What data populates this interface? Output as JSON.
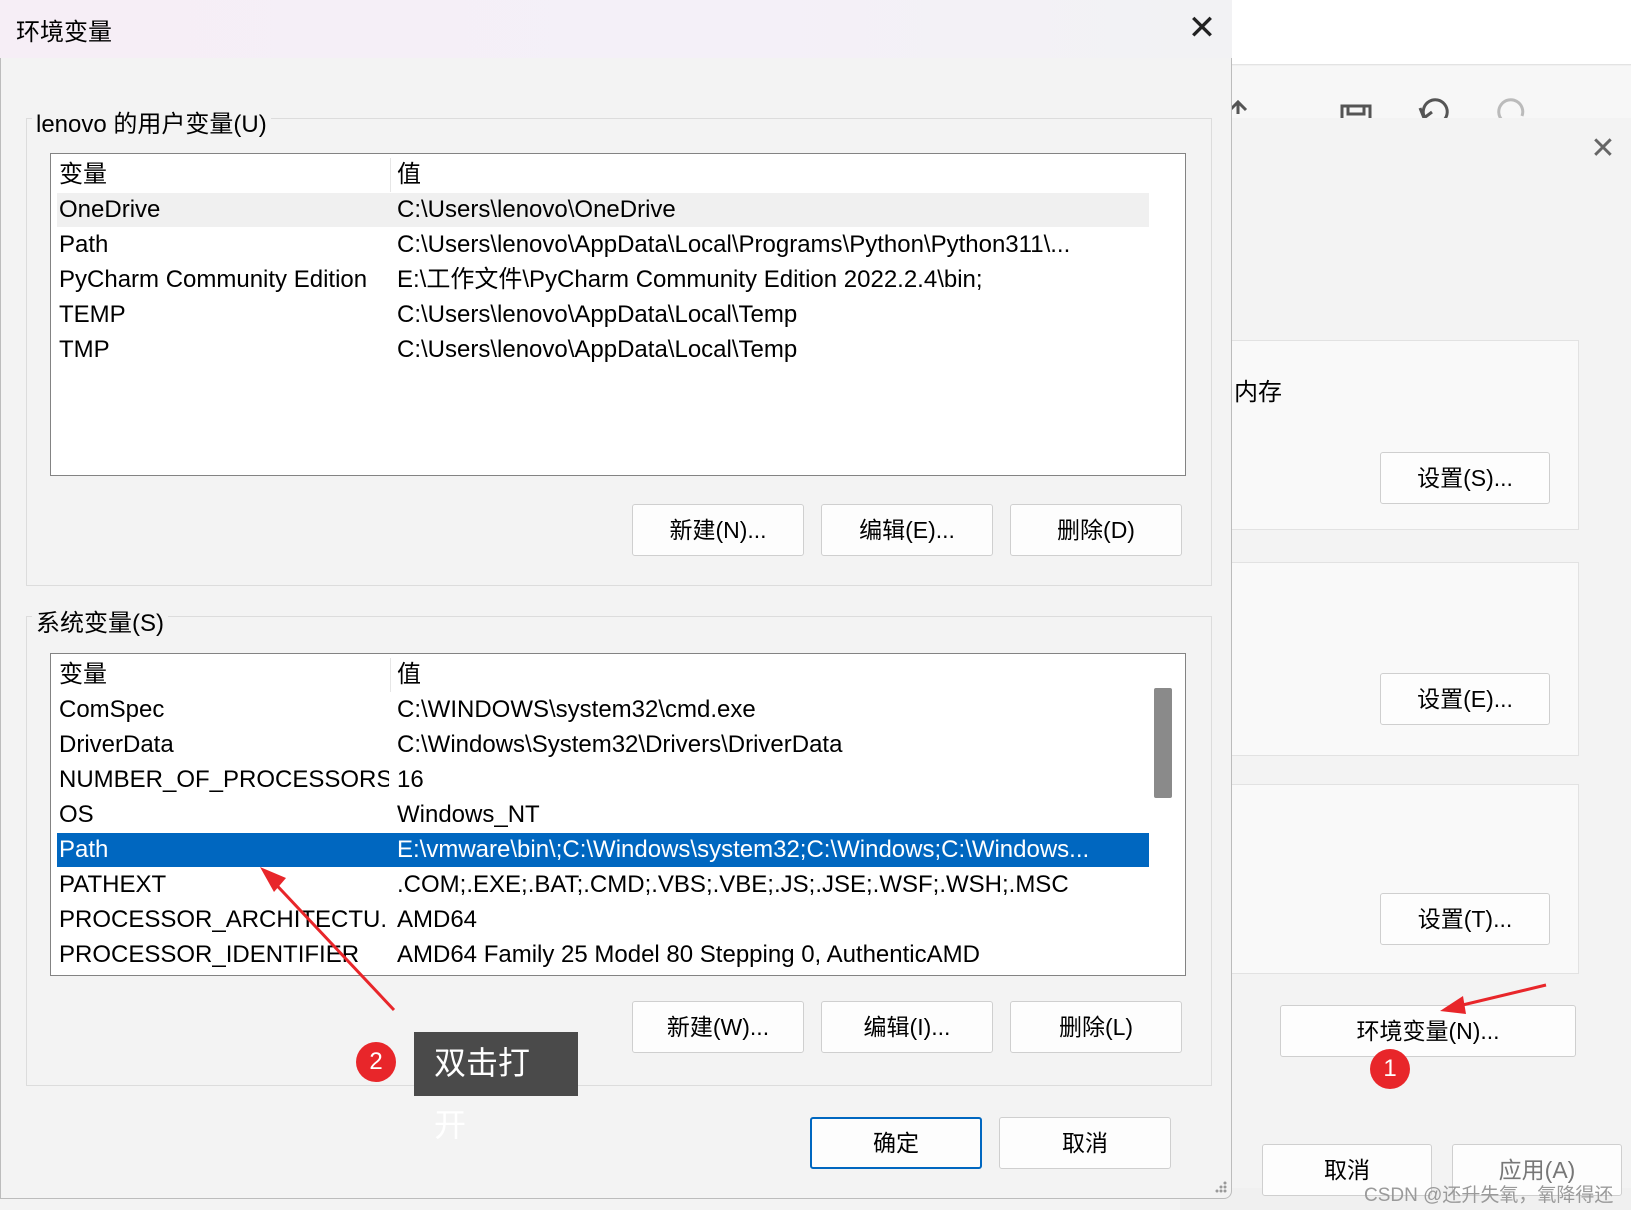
{
  "dialog": {
    "title": "环境变量",
    "close_glyph": "✕"
  },
  "user_vars": {
    "group_title": "lenovo 的用户变量(U)",
    "col_name": "变量",
    "col_value": "值",
    "rows": [
      {
        "name": "OneDrive",
        "value": "C:\\Users\\lenovo\\OneDrive"
      },
      {
        "name": "Path",
        "value": "C:\\Users\\lenovo\\AppData\\Local\\Programs\\Python\\Python311\\..."
      },
      {
        "name": "PyCharm Community Edition",
        "value": "E:\\工作文件\\PyCharm Community Edition 2022.2.4\\bin;"
      },
      {
        "name": "TEMP",
        "value": "C:\\Users\\lenovo\\AppData\\Local\\Temp"
      },
      {
        "name": "TMP",
        "value": "C:\\Users\\lenovo\\AppData\\Local\\Temp"
      }
    ],
    "btn_new": "新建(N)...",
    "btn_edit": "编辑(E)...",
    "btn_delete": "删除(D)"
  },
  "system_vars": {
    "group_title": "系统变量(S)",
    "col_name": "变量",
    "col_value": "值",
    "rows": [
      {
        "name": "ComSpec",
        "value": "C:\\WINDOWS\\system32\\cmd.exe"
      },
      {
        "name": "DriverData",
        "value": "C:\\Windows\\System32\\Drivers\\DriverData"
      },
      {
        "name": "NUMBER_OF_PROCESSORS",
        "value": "16"
      },
      {
        "name": "OS",
        "value": "Windows_NT"
      },
      {
        "name": "Path",
        "value": "E:\\vmware\\bin\\;C:\\Windows\\system32;C:\\Windows;C:\\Windows..."
      },
      {
        "name": "PATHEXT",
        "value": ".COM;.EXE;.BAT;.CMD;.VBS;.VBE;.JS;.JSE;.WSF;.WSH;.MSC"
      },
      {
        "name": "PROCESSOR_ARCHITECTU...",
        "value": "AMD64"
      },
      {
        "name": "PROCESSOR_IDENTIFIER",
        "value": "AMD64 Family 25 Model 80 Stepping 0, AuthenticAMD"
      }
    ],
    "selected_row": "Path",
    "btn_new": "新建(W)...",
    "btn_edit": "编辑(I)...",
    "btn_delete": "删除(L)"
  },
  "footer": {
    "ok": "确定",
    "cancel": "取消"
  },
  "background_window": {
    "close_glyph": "✕",
    "section_label": "内存",
    "btn_settings_s": "设置(S)...",
    "btn_settings_e": "设置(E)...",
    "btn_settings_t": "设置(T)...",
    "btn_env_vars": "环境变量(N)...",
    "btn_cancel": "取消",
    "btn_apply": "应用(A)"
  },
  "annotations": {
    "badge_1": "1",
    "badge_2": "2",
    "tooltip": "双击打开",
    "arrow_color": "#e8262a"
  },
  "watermark": "CSDN @还升失氧，氧降得还",
  "colors": {
    "selection": "#0067c0",
    "annotation_red": "#e8262a"
  }
}
